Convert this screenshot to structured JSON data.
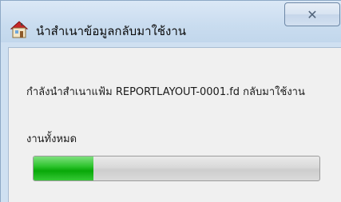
{
  "window": {
    "title": "นำสำเนาข้อมูลกลับมาใช้งาน",
    "close_symbol": "✕",
    "app_icon": "house-app-icon"
  },
  "content": {
    "status_text": "กำลังนำสำเนาแฟ้ม REPORTLAYOUT-0001.fd กลับมาใช้งาน",
    "progress_label": "งานทั้งหมด",
    "progress_value": 0.21
  },
  "colors": {
    "progress_fill": "#1cbf1c",
    "title_bar": "#c9dcef",
    "client_bg": "#f0f0f0"
  }
}
